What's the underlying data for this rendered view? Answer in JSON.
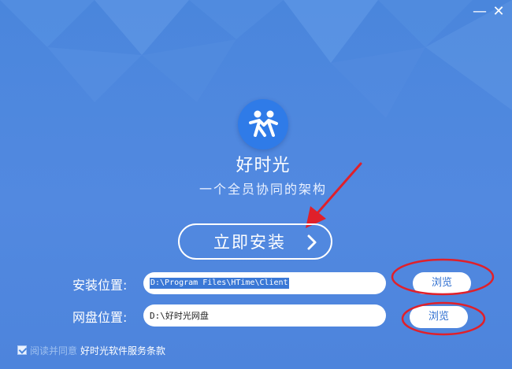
{
  "window": {
    "min_icon": "minimize-icon",
    "close_icon": "close-icon",
    "min_glyph": "—",
    "close_glyph": "✕"
  },
  "app": {
    "logo_icon": "two-people-logo-icon",
    "name": "好时光",
    "slogan": "一个全员协同的架构"
  },
  "install": {
    "button_label": "立即安装",
    "chevron_icon": "chevron-right-icon"
  },
  "install_path": {
    "label": "安装位置:",
    "value": "D:\\Program Files\\HTime\\Client",
    "browse_label": "浏览"
  },
  "disk_path": {
    "label": "网盘位置:",
    "value": "D:\\好时光网盘",
    "browse_label": "浏览"
  },
  "agreement": {
    "checked": true,
    "prefix": "阅读并同意",
    "link_text": "好时光软件服务条款"
  },
  "colors": {
    "background": "#4a86dc",
    "logo_bg": "#2f7be8",
    "annotation_red": "#e0202a",
    "button_text": "#2f6fd0"
  }
}
